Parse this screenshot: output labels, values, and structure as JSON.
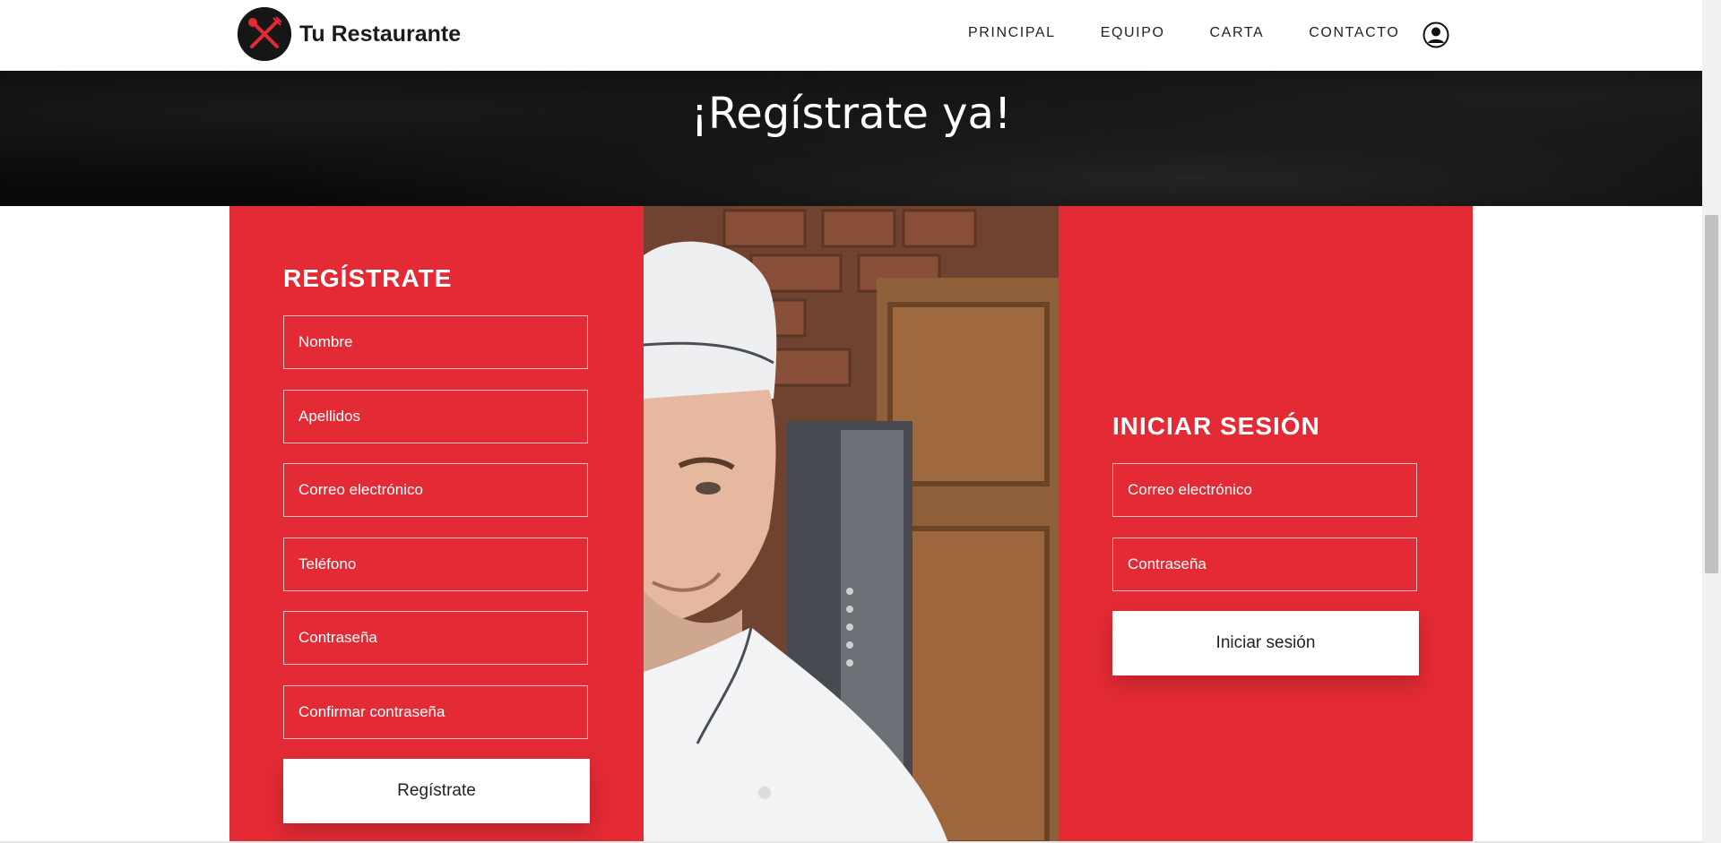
{
  "header": {
    "brand": "Tu Restaurante",
    "nav": [
      "PRINCIPAL",
      "EQUIPO",
      "CARTA",
      "CONTACTO"
    ],
    "user_icon": "user-circle-icon"
  },
  "hero": {
    "title": "¡Regístrate ya!"
  },
  "register": {
    "title": "REGÍSTRATE",
    "fields": [
      "Nombre",
      "Apellidos",
      "Correo electrónico",
      "Teléfono",
      "Contraseña",
      "Confirmar contraseña"
    ],
    "button": "Regístrate"
  },
  "login": {
    "title": "INICIAR SESIÓN",
    "fields": [
      "Correo electrónico",
      "Contraseña"
    ],
    "button": "Iniciar sesión"
  },
  "colors": {
    "accent": "#e42a34",
    "hero_bg": "#090909",
    "text_dark": "#1b1b1b"
  }
}
